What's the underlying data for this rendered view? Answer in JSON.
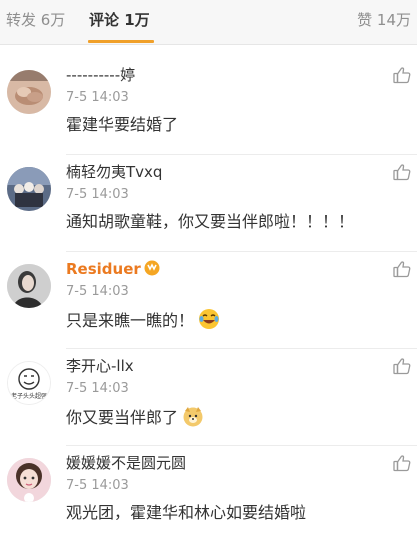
{
  "tabs": {
    "forward": "转发 6万",
    "comments": "评论 1万",
    "likes": "赞 14万"
  },
  "colors": {
    "accent": "#f0a02a",
    "username_highlight": "#eb7a20",
    "meta": "#9a9a9a"
  },
  "comments": [
    {
      "user": "----------婷",
      "time": "7-5 14:03",
      "text": "霍建华要结婚了"
    },
    {
      "user": "楠轻勿夷Tvxq",
      "time": "7-5 14:03",
      "text": "通知胡歌童鞋，你又要当伴郎啦！！！！"
    },
    {
      "user": "Residuer",
      "time": "7-5 14:03",
      "text": "只是来瞧一瞧的！",
      "badge": "vip-badge-icon",
      "emoji": "laughing-tears-emoji"
    },
    {
      "user": "李开心-llx",
      "time": "7-5 14:03",
      "text": "你又要当伴郎了",
      "emoji": "doge-emoji",
      "avatar_caption": "老子头头超强"
    },
    {
      "user": "媛媛媛不是圆元圆",
      "time": "7-5 14:03",
      "text": "观光团，霍建华和林心如要结婚啦"
    }
  ]
}
